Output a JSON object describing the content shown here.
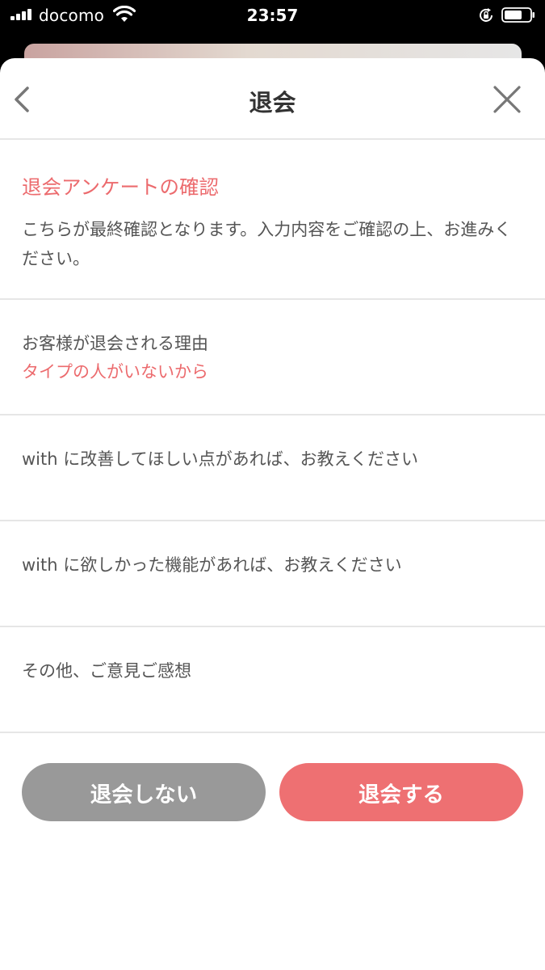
{
  "status_bar": {
    "carrier": "docomo",
    "time": "23:57"
  },
  "header": {
    "title": "退会"
  },
  "intro": {
    "title": "退会アンケートの確認",
    "description": "こちらが最終確認となります。入力内容をご確認の上、お進みください。"
  },
  "reason": {
    "label": "お客様が退会される理由",
    "answer": "タイプの人がいないから"
  },
  "questions": [
    {
      "label": "with に改善してほしい点があれば、お教えください",
      "answer": ""
    },
    {
      "label": "with に欲しかった機能があれば、お教えください",
      "answer": ""
    },
    {
      "label": "その他、ご意見ご感想",
      "answer": ""
    }
  ],
  "buttons": {
    "cancel_label": "退会しない",
    "confirm_label": "退会する"
  },
  "colors": {
    "accent": "#ee7072",
    "cancel_button": "#999999",
    "text": "#555555"
  },
  "icons": [
    "signal-icon",
    "wifi-icon",
    "rotation-lock-icon",
    "battery-icon",
    "chevron-left-icon",
    "close-icon"
  ]
}
